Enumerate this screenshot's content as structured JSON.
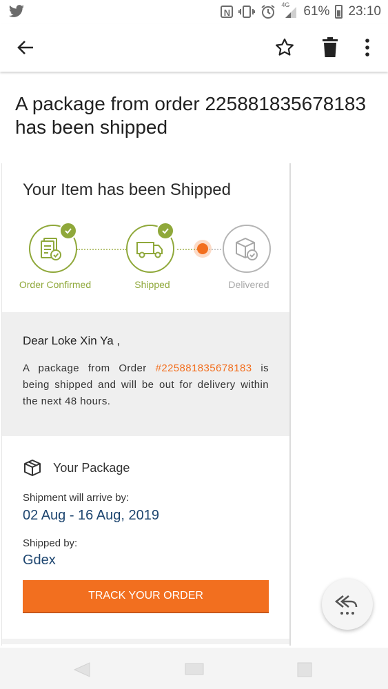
{
  "status_bar": {
    "network": "4G",
    "battery_percent": "61%",
    "time": "23:10",
    "icons": [
      "twitter-icon",
      "nfc-icon",
      "vibrate-icon",
      "alarm-icon",
      "signal-icon",
      "battery-icon"
    ]
  },
  "app_bar": {
    "icons": [
      "back-arrow-icon",
      "star-icon",
      "trash-icon",
      "more-vert-icon"
    ]
  },
  "email": {
    "subject": "A package from order 225881835678183 has been shipped",
    "card_title": "Your Item has been Shipped",
    "steps": [
      {
        "label": "Order Confirmed",
        "status": "done",
        "icon": "document-check-icon"
      },
      {
        "label": "Shipped",
        "status": "done",
        "icon": "truck-icon"
      },
      {
        "label": "Delivered",
        "status": "pending",
        "icon": "box-check-icon"
      }
    ],
    "greeting": "Dear Loke Xin Ya ,",
    "body_prefix": "A package from Order ",
    "order_number": "#225881835678183",
    "body_suffix": " is being shipped and will be out for delivery within the next 48 hours.",
    "package_heading": "Your Package",
    "arrive_label": "Shipment will arrive by:",
    "arrive_value": "02 Aug - 16 Aug, 2019",
    "shipped_by_label": "Shipped by:",
    "shipped_by_value": "Gdex",
    "track_button": "TRACK YOUR ORDER"
  },
  "colors": {
    "accent_orange": "#f26f1f",
    "step_green": "#8fa83a",
    "value_blue": "#1e4670",
    "pending_grey": "#a8a8a8"
  },
  "fab_icon": "reply-all-icon",
  "nav_icons": [
    "nav-back-icon",
    "nav-home-icon",
    "nav-recents-icon"
  ]
}
